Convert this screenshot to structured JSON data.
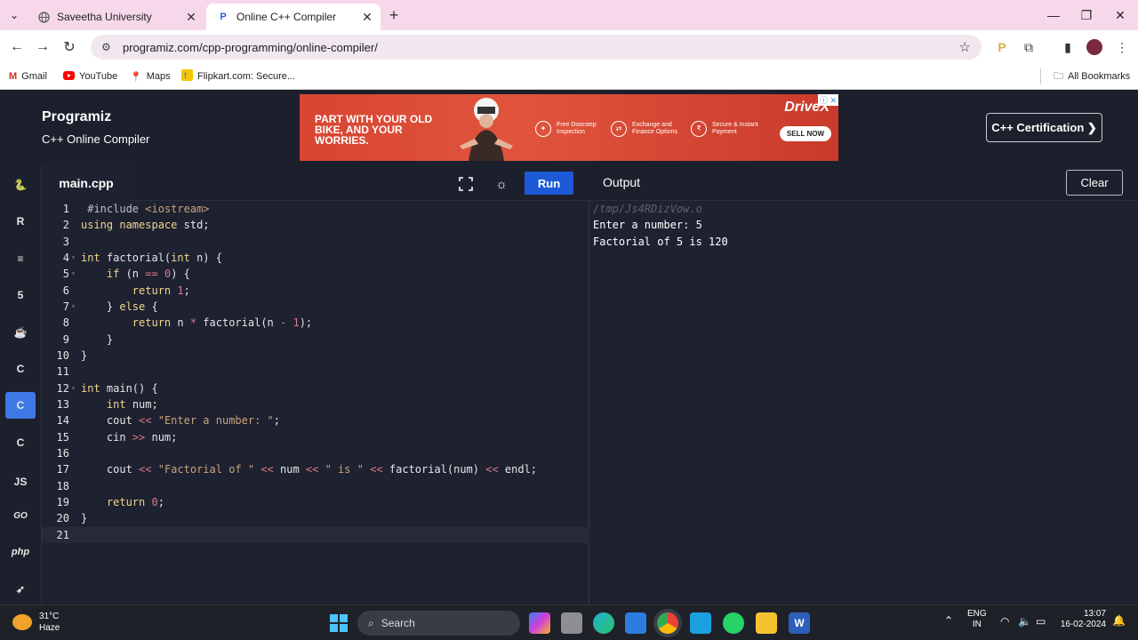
{
  "browser": {
    "tabs": [
      {
        "title": "Saveetha University",
        "active": false
      },
      {
        "title": "Online C++ Compiler",
        "active": true
      }
    ],
    "url": "programiz.com/cpp-programming/online-compiler/",
    "bookmarks": [
      {
        "label": "Gmail",
        "icon": "gmail-icon"
      },
      {
        "label": "YouTube",
        "icon": "youtube-icon"
      },
      {
        "label": "Maps",
        "icon": "maps-icon"
      },
      {
        "label": "Flipkart.com: Secure...",
        "icon": "flipkart-icon"
      }
    ],
    "all_bookmarks": "All Bookmarks"
  },
  "site": {
    "logo": "Programiz",
    "subtitle": "C++ Online Compiler",
    "certification": "C++ Certification ❯",
    "ad": {
      "headline": "PART WITH YOUR OLD BIKE, AND YOUR WORRIES.",
      "features": [
        "Free Doorstep Inspection",
        "Exchange and Finance Options",
        "Secure & Instant Payment"
      ],
      "brand": "DriveX",
      "cta": "SELL NOW"
    }
  },
  "languages": [
    {
      "name": "python-icon",
      "glyph": "🐍",
      "active": false
    },
    {
      "name": "r-icon",
      "glyph": "R",
      "active": false
    },
    {
      "name": "sql-icon",
      "glyph": "≡",
      "active": false
    },
    {
      "name": "html-icon",
      "glyph": "5",
      "active": false
    },
    {
      "name": "java-icon",
      "glyph": "☕",
      "active": false
    },
    {
      "name": "c-icon",
      "glyph": "C",
      "active": false
    },
    {
      "name": "cpp-icon",
      "glyph": "C",
      "active": true
    },
    {
      "name": "csharp-icon",
      "glyph": "C",
      "active": false
    },
    {
      "name": "js-icon",
      "glyph": "JS",
      "active": false
    },
    {
      "name": "go-icon",
      "glyph": "GO",
      "active": false
    },
    {
      "name": "php-icon",
      "glyph": "php",
      "active": false
    },
    {
      "name": "swift-icon",
      "glyph": "➶",
      "active": false
    }
  ],
  "editor": {
    "filename": "main.cpp",
    "run_label": "Run",
    "lines": [
      "#include <iostream>",
      "using namespace std;",
      "",
      "int factorial(int n) {",
      "    if (n == 0) {",
      "        return 1;",
      "    } else {",
      "        return n * factorial(n - 1);",
      "    }",
      "}",
      "",
      "int main() {",
      "    int num;",
      "    cout << \"Enter a number: \";",
      "    cin >> num;",
      "",
      "    cout << \"Factorial of \" << num << \" is \" << factorial(num) << endl;",
      "",
      "    return 0;",
      "}",
      ""
    ]
  },
  "output": {
    "title": "Output",
    "clear_label": "Clear",
    "lines": [
      "/tmp/Js4RDizVow.o",
      "Enter a number: 5",
      "Factorial of 5 is 120"
    ]
  },
  "taskbar": {
    "temp": "31°C",
    "condition": "Haze",
    "search": "Search",
    "lang": "ENG",
    "region": "IN",
    "time": "13:07",
    "date": "16-02-2024"
  }
}
